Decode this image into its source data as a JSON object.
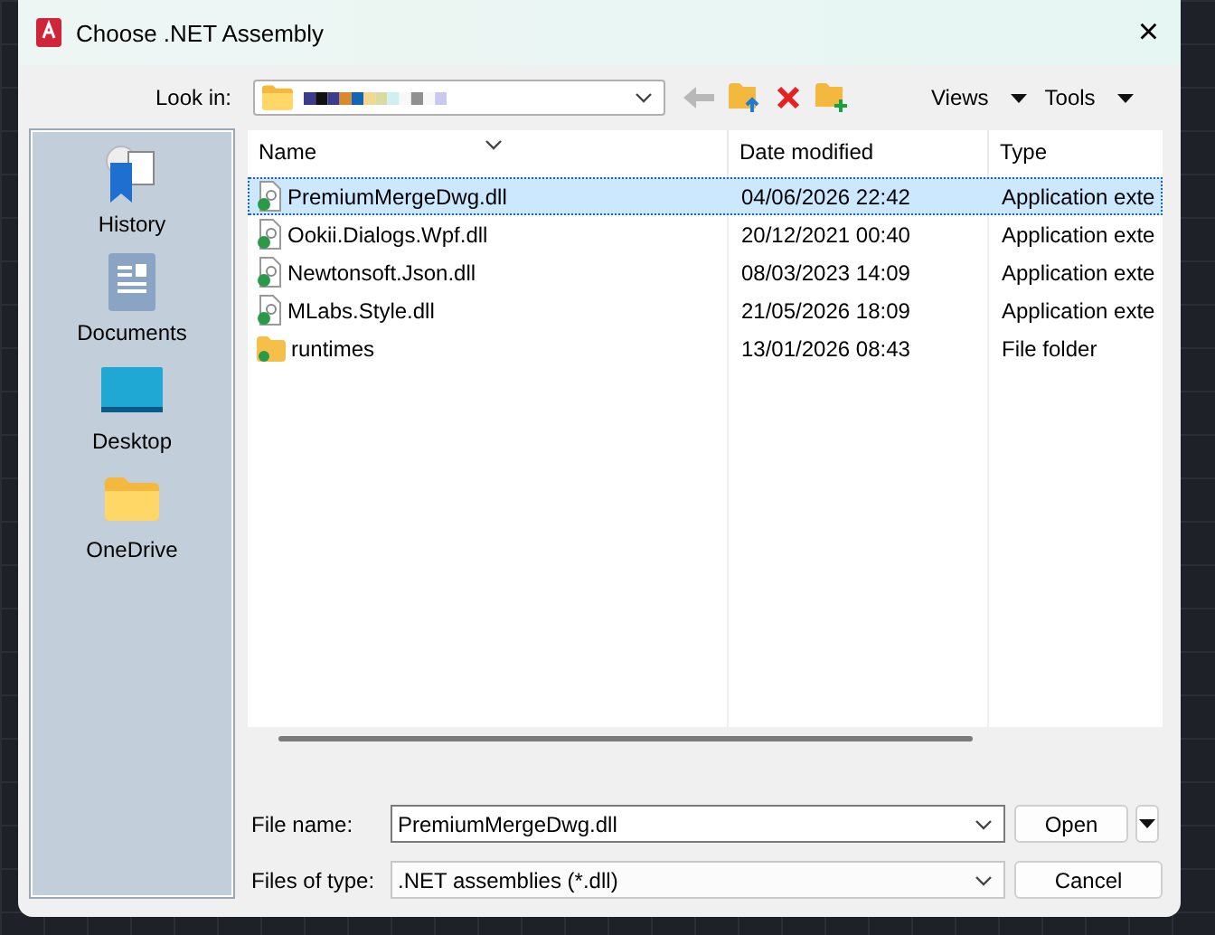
{
  "window": {
    "title": "Choose .NET Assembly",
    "close": "×"
  },
  "toolbar": {
    "look_in_label": "Look in:",
    "views": "Views",
    "tools": "Tools"
  },
  "places": [
    {
      "label": "History",
      "kind": "history"
    },
    {
      "label": "Documents",
      "kind": "documents"
    },
    {
      "label": "Desktop",
      "kind": "desktop"
    },
    {
      "label": "OneDrive",
      "kind": "folder"
    }
  ],
  "table": {
    "columns": [
      "Name",
      "Date modified",
      "Type"
    ],
    "rows": [
      {
        "kind": "dll",
        "name": "PremiumMergeDwg.dll",
        "date": "04/06/2026 22:42",
        "type": "Application exte",
        "selected": true
      },
      {
        "kind": "dll",
        "name": "Ookii.Dialogs.Wpf.dll",
        "date": "20/12/2021 00:40",
        "type": "Application exte",
        "selected": false
      },
      {
        "kind": "dll",
        "name": "Newtonsoft.Json.dll",
        "date": "08/03/2023 14:09",
        "type": "Application exte",
        "selected": false
      },
      {
        "kind": "dll",
        "name": "MLabs.Style.dll",
        "date": "21/05/2026 18:09",
        "type": "Application exte",
        "selected": false
      },
      {
        "kind": "folder",
        "name": "runtimes",
        "date": "13/01/2026 08:43",
        "type": "File folder",
        "selected": false
      }
    ]
  },
  "file_name": {
    "label": "File name:",
    "value": "PremiumMergeDwg.dll"
  },
  "file_type": {
    "label": "Files of type:",
    "value": ".NET assemblies (*.dll)"
  },
  "buttons": {
    "open": "Open",
    "cancel": "Cancel"
  }
}
